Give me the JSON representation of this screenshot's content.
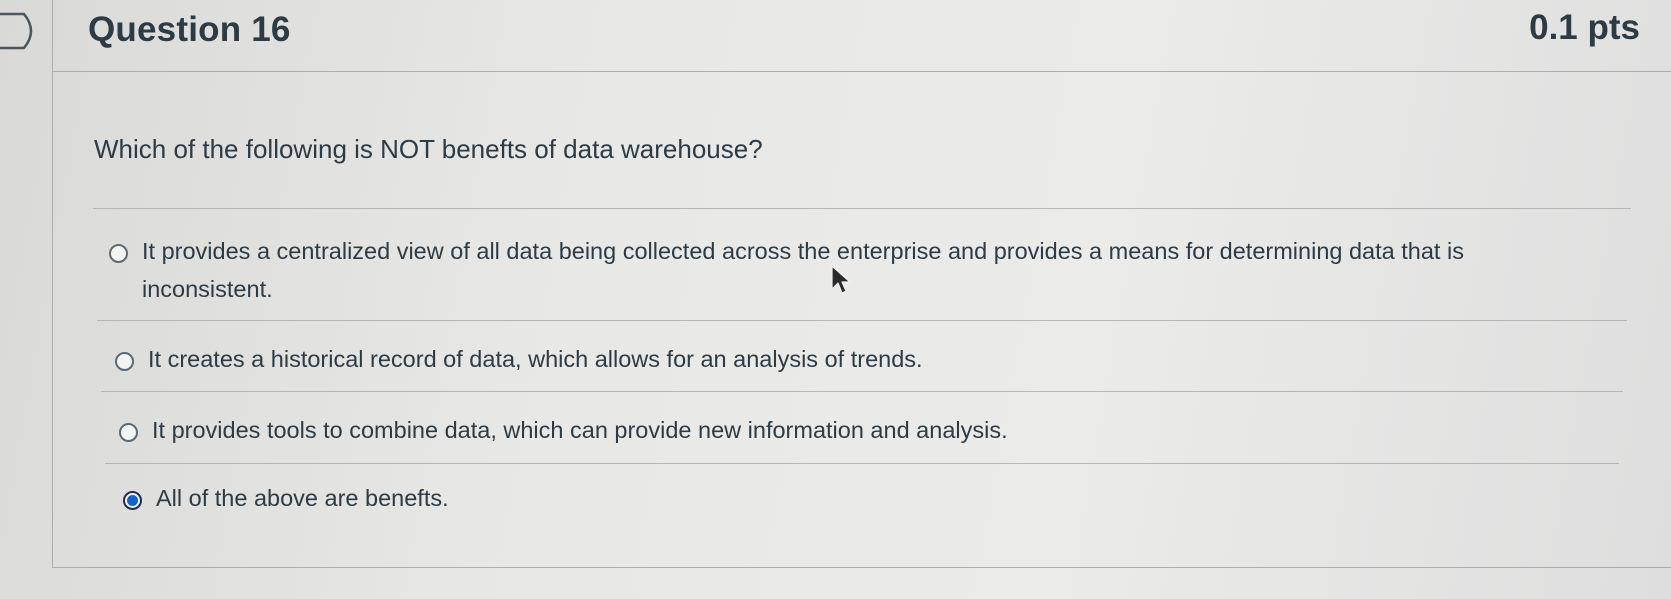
{
  "question": {
    "title": "Question 16",
    "points": "0.1 pts",
    "text": "Which of the following is NOT benefts of data warehouse?"
  },
  "answers": [
    {
      "label": "It provides a centralized view of all data being collected across the enterprise and provides a means for determining data that is inconsistent.",
      "selected": false
    },
    {
      "label": "It creates a historical record of data, which allows for an analysis of trends.",
      "selected": false
    },
    {
      "label": "It provides tools to combine data, which can provide new information and analysis.",
      "selected": false
    },
    {
      "label": "All of the above are benefts.",
      "selected": true
    }
  ],
  "colors": {
    "text": "#2d3b45",
    "selected_radio": "#1662c4",
    "border": "#a9aeb1"
  },
  "icons": {
    "flag": "question-flag-icon",
    "cursor": "mouse-pointer-icon"
  }
}
